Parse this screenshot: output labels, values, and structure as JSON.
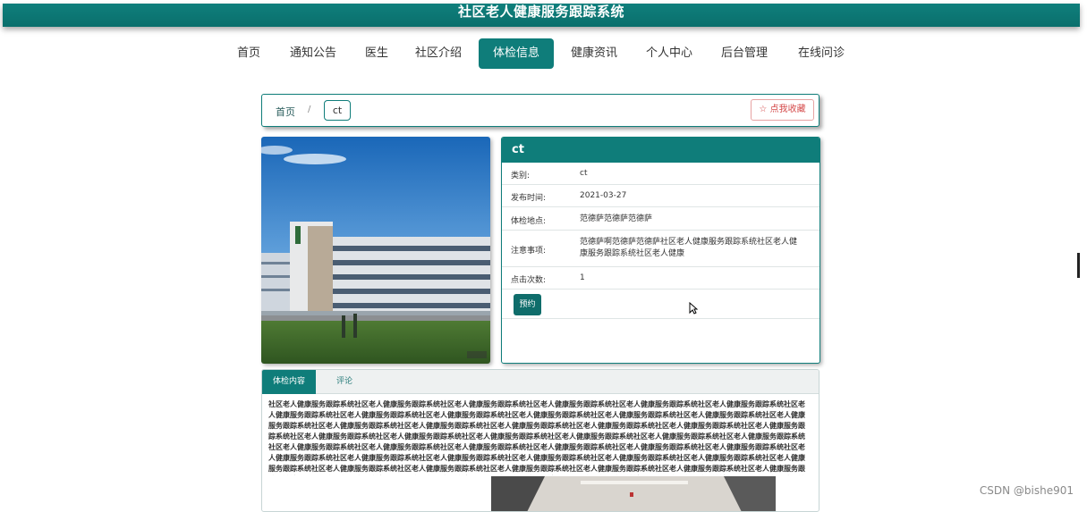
{
  "header": {
    "title": "社区老人健康服务跟踪系统"
  },
  "nav": {
    "items": [
      "首页",
      "通知公告",
      "医生",
      "社区介绍",
      "体检信息",
      "健康资讯",
      "个人中心",
      "后台管理",
      "在线问诊"
    ],
    "active_index": 4
  },
  "breadcrumb": {
    "home": "首页",
    "separator": "/",
    "current": "ct"
  },
  "favorite_button": {
    "icon": "star-outline-icon",
    "label": "☆ 点我收藏"
  },
  "detail": {
    "title": "ct",
    "rows": [
      {
        "label": "类别:",
        "value": "ct"
      },
      {
        "label": "发布时间:",
        "value": "2021-03-27"
      },
      {
        "label": "体检地点:",
        "value": "范德萨范德萨范德萨"
      },
      {
        "label": "注意事项:",
        "value": "范德萨啊范德萨范德萨社区老人健康服务跟踪系统社区老人健康服务跟踪系统社区老人健康"
      },
      {
        "label": "点击次数:",
        "value": "1"
      }
    ],
    "book_button": "预约"
  },
  "tabs": {
    "items": [
      "体检内容",
      "评论"
    ],
    "active_index": 0
  },
  "content": {
    "text": "社区老人健康服务跟踪系统社区老人健康服务跟踪系统社区老人健康服务跟踪系统社区老人健康服务跟踪系统社区老人健康服务跟踪系统社区老人健康服务跟踪系统社区老人健康服务跟踪系统社区老人健康服务跟踪系统社区老人健康服务跟踪系统社区老人健康服务跟踪系统社区老人健康服务跟踪系统社区老人健康服务跟踪系统社区老人健康服务跟踪系统社区老人健康服务跟踪系统社区老人健康服务跟踪系统社区老人健康服务跟踪系统社区老人健康服务跟踪系统社区老人健康服务跟踪系统社区老人健康服务跟踪系统社区老人健康服务跟踪系统社区老人健康服务跟踪系统社区老人健康服务跟踪系统社区老人健康服务跟踪系统社区老人健康服务跟踪系统社区老人健康服务跟踪系统社区老人健康服务跟踪系统社区老人健康服务跟踪系统社区老人健康服务跟踪系统社区老人健康服务跟踪系统社区老人健康服务跟踪系统社区老人健康服务跟踪系统社区老人健康服务跟踪系统社区老人健康服务跟踪系统社区老人健康服务跟踪系统社区老人健康服务跟踪系统社区老人健康服务跟踪系统社区老人健康服务跟踪系统社区老人健康服务跟踪系统社区老人健康服务跟踪系统社区老人健康服务跟踪系统社区老人健康服务跟踪系统社区老人健康服务跟踪系统社区老人健康服务跟踪系统社区老人健康服务跟踪系统社区老人健康服务跟踪系统社区老人健康服务跟踪系统社区老人健康服务跟踪系统社区老人健康服务跟踪系统社区老人健康服务跟踪系统社区老人健康服务跟踪系统社区老人健康服务跟踪系统社区老人健康服务跟踪系统社区老人健康服务跟踪系统社区老人健康服务跟踪系统社区老人健康服务跟踪系统"
  },
  "watermark": "CSDN @bishe901",
  "colors": {
    "primary": "#0f7d7a",
    "favorite": "#d44848"
  }
}
